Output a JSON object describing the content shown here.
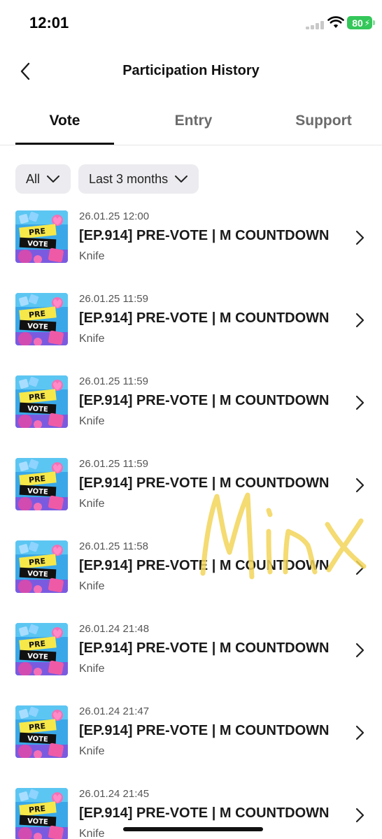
{
  "status_bar": {
    "time": "12:01",
    "battery": "80"
  },
  "header": {
    "title": "Participation History"
  },
  "tabs": [
    {
      "label": "Vote",
      "active": true
    },
    {
      "label": "Entry",
      "active": false
    },
    {
      "label": "Support",
      "active": false
    }
  ],
  "filters": {
    "type": "All",
    "period": "Last 3 months"
  },
  "items": [
    {
      "date": "26.01.25 12:00",
      "title": "[EP.914] PRE-VOTE | M COUNTDOWN",
      "sub": "Knife",
      "thumb_top": "PRE",
      "thumb_bottom": "VOTE"
    },
    {
      "date": "26.01.25 11:59",
      "title": "[EP.914] PRE-VOTE | M COUNTDOWN",
      "sub": "Knife",
      "thumb_top": "PRE",
      "thumb_bottom": "VOTE"
    },
    {
      "date": "26.01.25 11:59",
      "title": "[EP.914] PRE-VOTE | M COUNTDOWN",
      "sub": "Knife",
      "thumb_top": "PRE",
      "thumb_bottom": "VOTE"
    },
    {
      "date": "26.01.25 11:59",
      "title": "[EP.914] PRE-VOTE | M COUNTDOWN",
      "sub": "Knife",
      "thumb_top": "PRE",
      "thumb_bottom": "VOTE"
    },
    {
      "date": "26.01.25 11:58",
      "title": "[EP.914] PRE-VOTE | M COUNTDOWN",
      "sub": "Knife",
      "thumb_top": "PRE",
      "thumb_bottom": "VOTE"
    },
    {
      "date": "26.01.24 21:48",
      "title": "[EP.914] PRE-VOTE | M COUNTDOWN",
      "sub": "Knife",
      "thumb_top": "PRE",
      "thumb_bottom": "VOTE"
    },
    {
      "date": "26.01.24 21:47",
      "title": "[EP.914] PRE-VOTE | M COUNTDOWN",
      "sub": "Knife",
      "thumb_top": "PRE",
      "thumb_bottom": "VOTE"
    },
    {
      "date": "26.01.24 21:45",
      "title": "[EP.914] PRE-VOTE | M COUNTDOWN",
      "sub": "Knife",
      "thumb_top": "PRE",
      "thumb_bottom": "VOTE"
    }
  ],
  "watermark": {
    "text": "Minx",
    "color": "#f3d55a"
  },
  "colors": {
    "accent": "#111111",
    "filter_bg": "#ececf0",
    "battery": "#34c759"
  }
}
